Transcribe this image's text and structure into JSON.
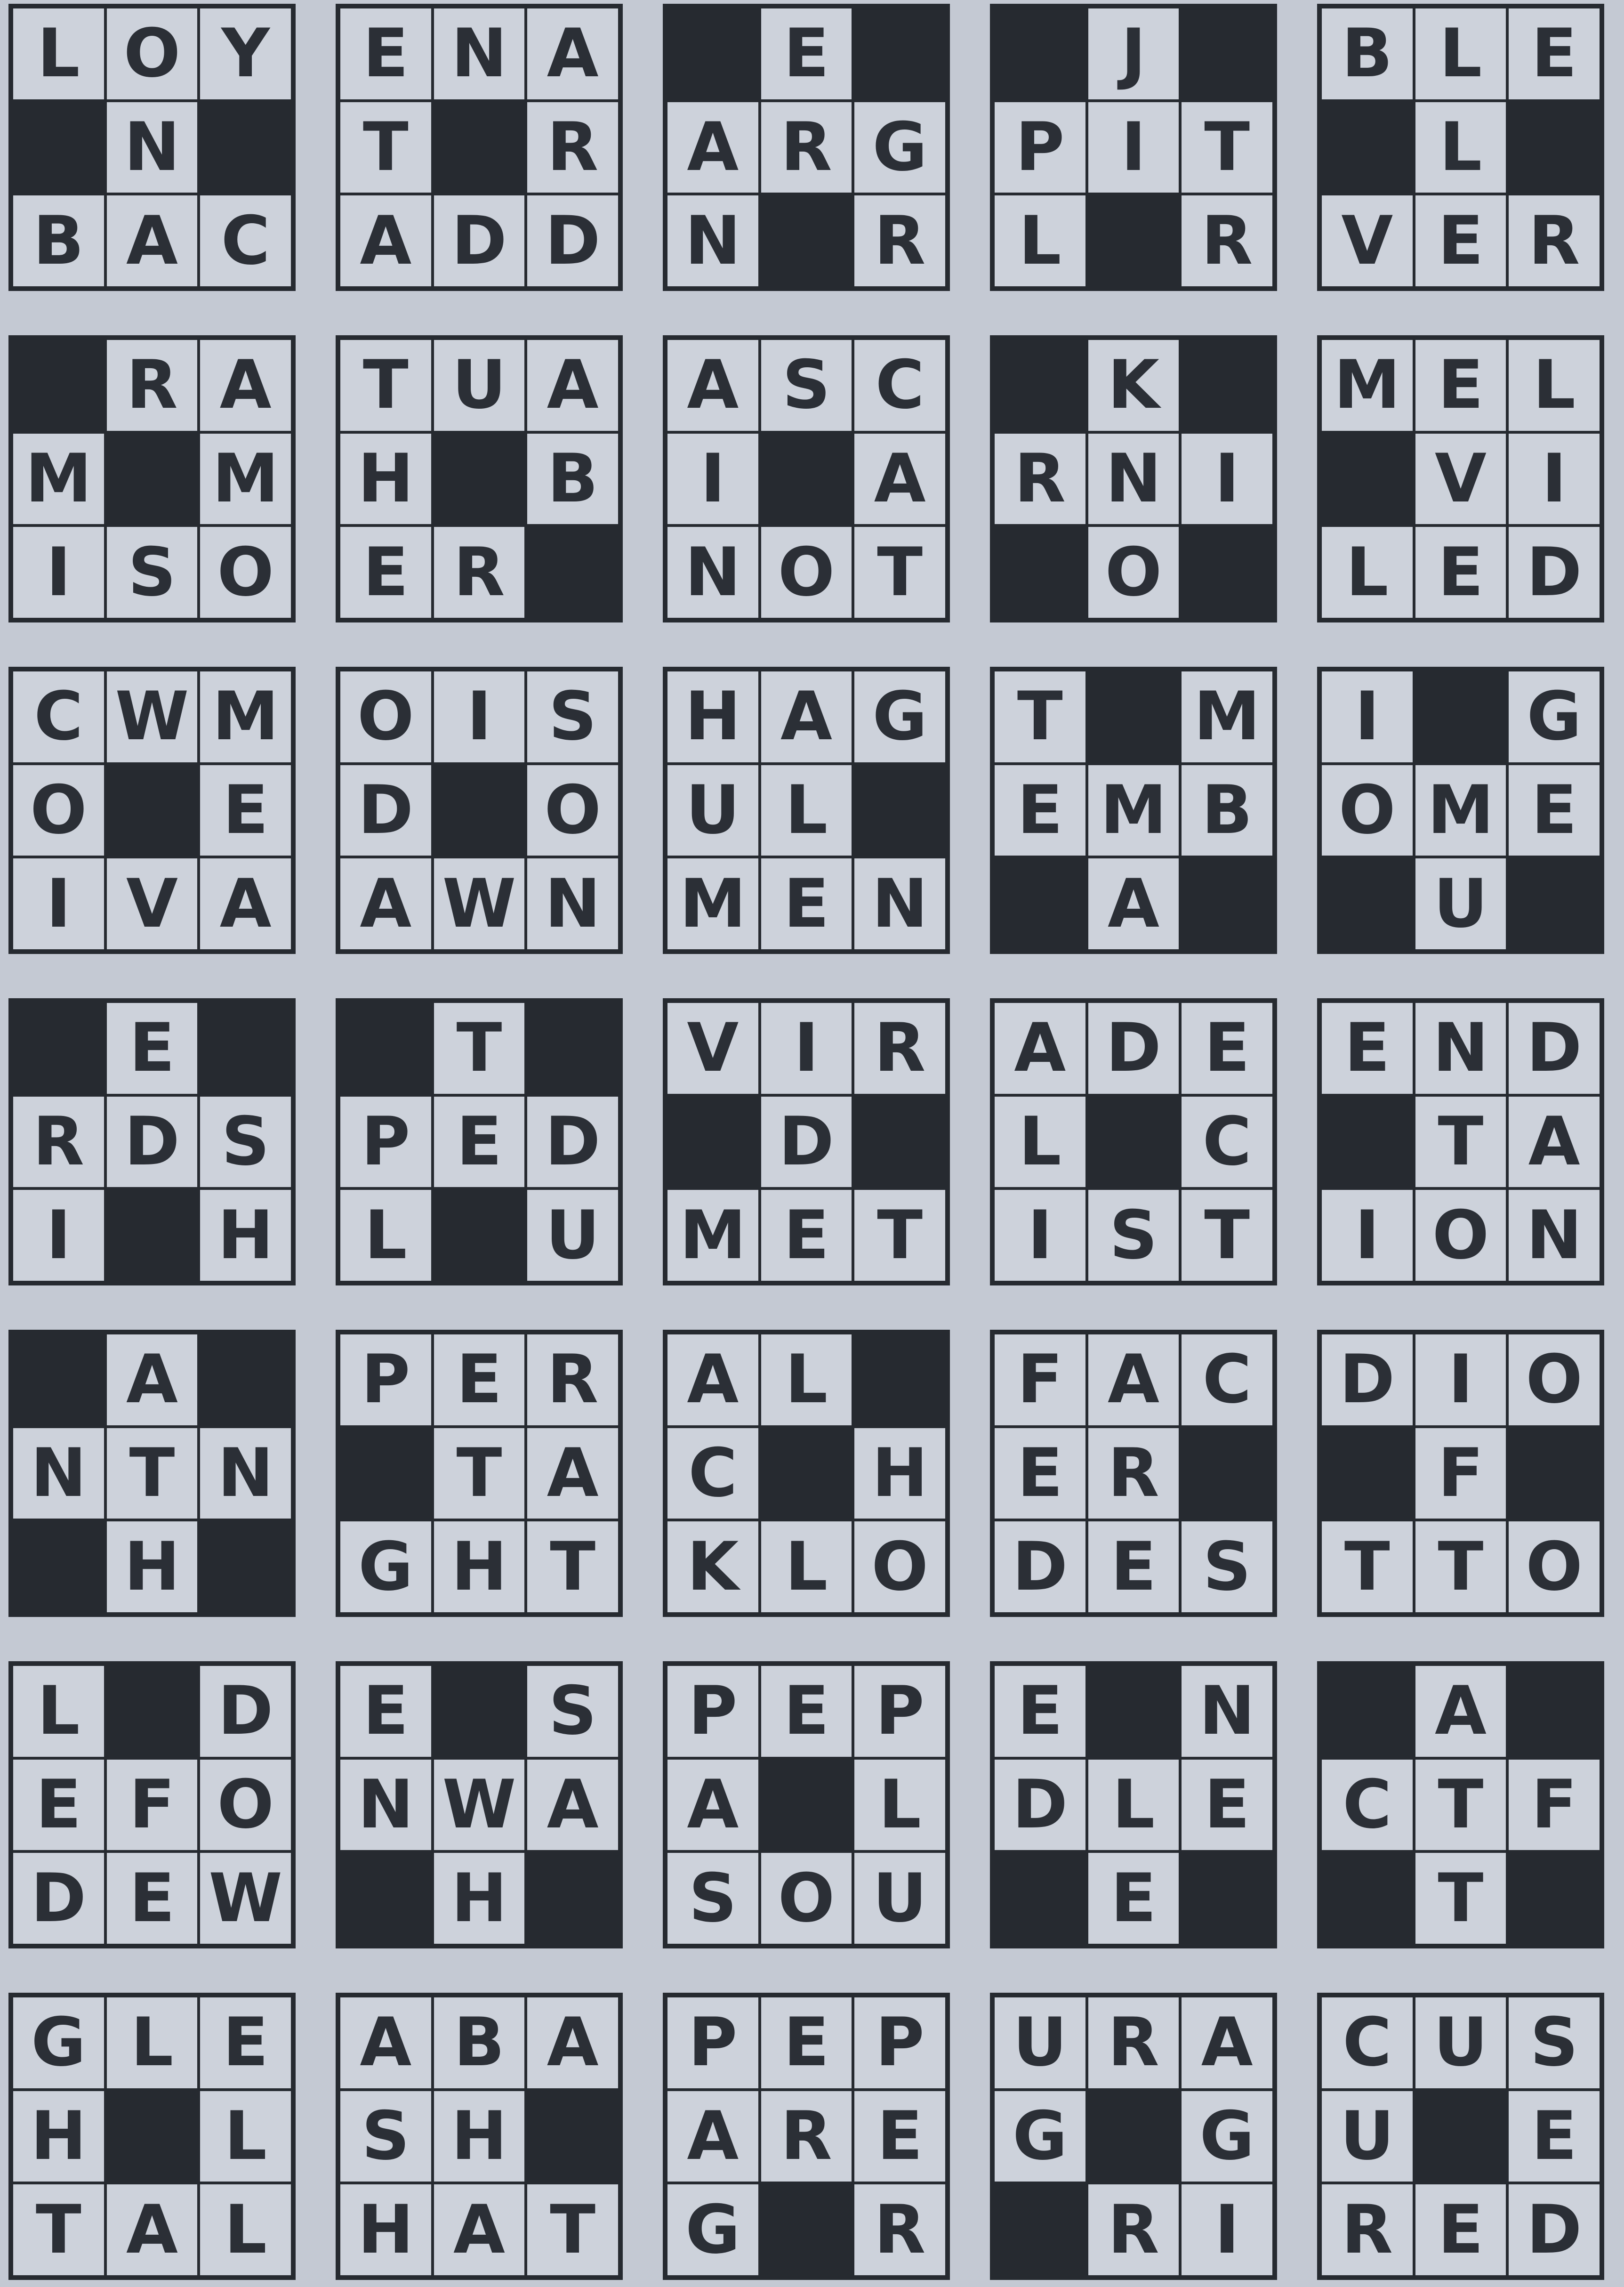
{
  "puzzle": {
    "tiles": [
      [
        "L",
        "O",
        "Y",
        "#",
        "N",
        "#",
        "B",
        "A",
        "C"
      ],
      [
        "E",
        "N",
        "A",
        "T",
        "#",
        "R",
        "A",
        "D",
        "D"
      ],
      [
        "#",
        "E",
        "#",
        "A",
        "R",
        "G",
        "N",
        "#",
        "R"
      ],
      [
        "#",
        "J",
        "#",
        "P",
        "I",
        "T",
        "L",
        "#",
        "R"
      ],
      [
        "B",
        "L",
        "E",
        "#",
        "L",
        "#",
        "V",
        "E",
        "R"
      ],
      [
        "#",
        "R",
        "A",
        "M",
        "#",
        "M",
        "I",
        "S",
        "O"
      ],
      [
        "T",
        "U",
        "A",
        "H",
        "#",
        "B",
        "E",
        "R",
        "#"
      ],
      [
        "A",
        "S",
        "C",
        "I",
        "#",
        "A",
        "N",
        "O",
        "T"
      ],
      [
        "#",
        "K",
        "#",
        "R",
        "N",
        "I",
        "#",
        "O",
        "#"
      ],
      [
        "M",
        "E",
        "L",
        "#",
        "V",
        "I",
        "L",
        "E",
        "D"
      ],
      [
        "C",
        "W",
        "M",
        "O",
        "#",
        "E",
        "I",
        "V",
        "A"
      ],
      [
        "O",
        "I",
        "S",
        "D",
        "#",
        "O",
        "A",
        "W",
        "N"
      ],
      [
        "H",
        "A",
        "G",
        "U",
        "L",
        "#",
        "M",
        "E",
        "N"
      ],
      [
        "T",
        "#",
        "M",
        "E",
        "M",
        "B",
        "#",
        "A",
        "#"
      ],
      [
        "I",
        "#",
        "G",
        "O",
        "M",
        "E",
        "#",
        "U",
        "#"
      ],
      [
        "#",
        "E",
        "#",
        "R",
        "D",
        "S",
        "I",
        "#",
        "H"
      ],
      [
        "#",
        "T",
        "#",
        "P",
        "E",
        "D",
        "L",
        "#",
        "U"
      ],
      [
        "V",
        "I",
        "R",
        "#",
        "D",
        "#",
        "M",
        "E",
        "T"
      ],
      [
        "A",
        "D",
        "E",
        "L",
        "#",
        "C",
        "I",
        "S",
        "T"
      ],
      [
        "E",
        "N",
        "D",
        "#",
        "T",
        "A",
        "I",
        "O",
        "N"
      ],
      [
        "#",
        "A",
        "#",
        "N",
        "T",
        "N",
        "#",
        "H",
        "#"
      ],
      [
        "P",
        "E",
        "R",
        "#",
        "T",
        "A",
        "G",
        "H",
        "T"
      ],
      [
        "A",
        "L",
        "#",
        "C",
        "#",
        "H",
        "K",
        "L",
        "O"
      ],
      [
        "F",
        "A",
        "C",
        "E",
        "R",
        "#",
        "D",
        "E",
        "S"
      ],
      [
        "D",
        "I",
        "O",
        "#",
        "F",
        "#",
        "T",
        "T",
        "O"
      ],
      [
        "L",
        "#",
        "D",
        "E",
        "F",
        "O",
        "D",
        "E",
        "W"
      ],
      [
        "E",
        "#",
        "S",
        "N",
        "W",
        "A",
        "#",
        "H",
        "#"
      ],
      [
        "P",
        "E",
        "P",
        "A",
        "#",
        "L",
        "S",
        "O",
        "U"
      ],
      [
        "E",
        "#",
        "N",
        "D",
        "L",
        "E",
        "#",
        "E",
        "#"
      ],
      [
        "#",
        "A",
        "#",
        "C",
        "T",
        "F",
        "#",
        "T",
        "#"
      ],
      [
        "G",
        "L",
        "E",
        "H",
        "#",
        "L",
        "T",
        "A",
        "L"
      ],
      [
        "A",
        "B",
        "A",
        "S",
        "H",
        "#",
        "H",
        "A",
        "T"
      ],
      [
        "P",
        "E",
        "P",
        "A",
        "R",
        "E",
        "G",
        "#",
        "R"
      ],
      [
        "U",
        "R",
        "A",
        "G",
        "#",
        "G",
        "#",
        "R",
        "I"
      ],
      [
        "C",
        "U",
        "S",
        "U",
        "#",
        "E",
        "R",
        "E",
        "D"
      ]
    ]
  }
}
